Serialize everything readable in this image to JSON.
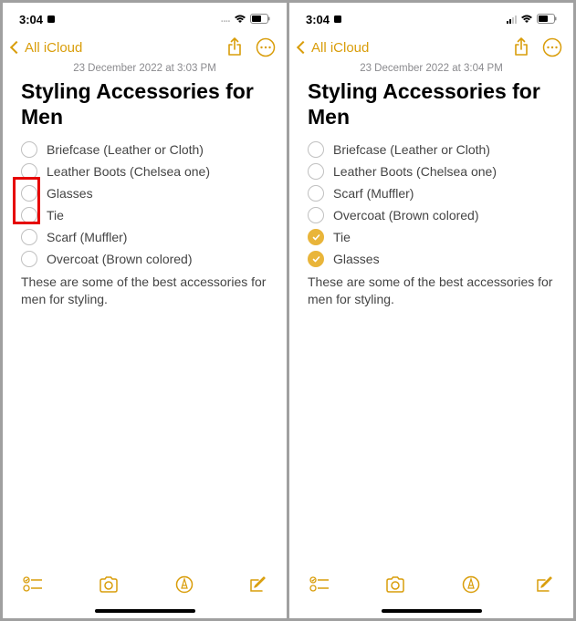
{
  "colors": {
    "accent": "#d99d0a",
    "check": "#e9b53a",
    "highlight": "#e60000"
  },
  "left": {
    "status": {
      "time": "3:04"
    },
    "navBack": "All iCloud",
    "timestamp": "23 December 2022 at 3:03 PM",
    "title": "Styling Accessories for Men",
    "items": [
      {
        "label": "Briefcase (Leather or Cloth)",
        "checked": false
      },
      {
        "label": "Leather Boots (Chelsea one)",
        "checked": false
      },
      {
        "label": "Glasses",
        "checked": false
      },
      {
        "label": "Tie",
        "checked": false
      },
      {
        "label": "Scarf (Muffler)",
        "checked": false
      },
      {
        "label": "Overcoat (Brown colored)",
        "checked": false
      }
    ],
    "body": "These are some of the best accessories for men for styling."
  },
  "right": {
    "status": {
      "time": "3:04"
    },
    "navBack": "All iCloud",
    "timestamp": "23 December 2022 at 3:04 PM",
    "title": "Styling Accessories for Men",
    "items": [
      {
        "label": "Briefcase (Leather or Cloth)",
        "checked": false
      },
      {
        "label": "Leather Boots (Chelsea one)",
        "checked": false
      },
      {
        "label": "Scarf (Muffler)",
        "checked": false
      },
      {
        "label": "Overcoat (Brown colored)",
        "checked": false
      },
      {
        "label": "Tie",
        "checked": true
      },
      {
        "label": "Glasses",
        "checked": true
      }
    ],
    "body": "These are some of the best accessories for men for styling."
  }
}
